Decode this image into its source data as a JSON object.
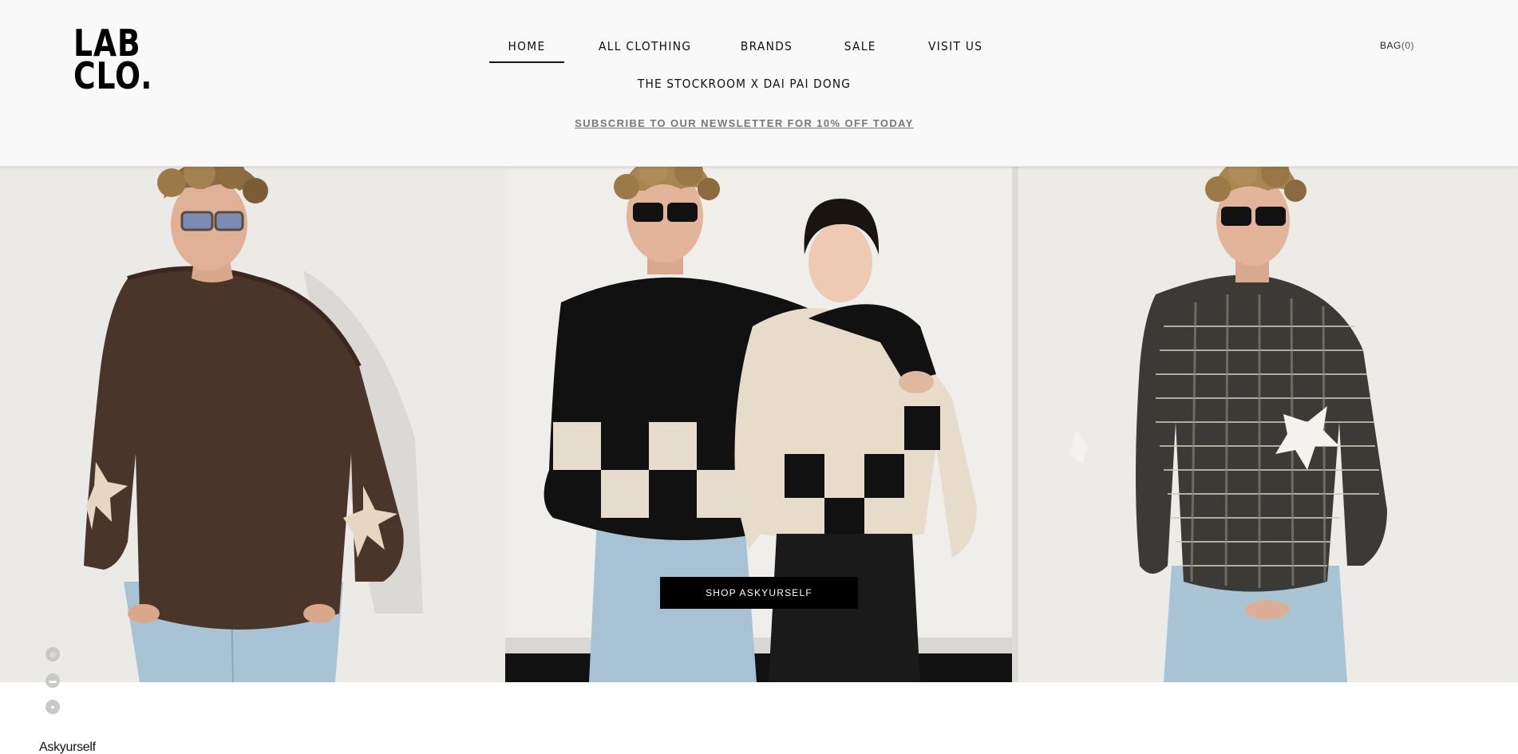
{
  "header": {
    "logo": {
      "line1": "LAB",
      "line2": "CLO."
    },
    "nav": [
      {
        "label": "HOME",
        "active": true
      },
      {
        "label": "ALL CLOTHING",
        "active": false
      },
      {
        "label": "BRANDS",
        "active": false
      },
      {
        "label": "SALE",
        "active": false
      },
      {
        "label": "VISIT US",
        "active": false
      }
    ],
    "nav_secondary": "THE STOCKROOM X DAI PAI DONG",
    "newsletter": "SUBSCRIBE TO OUR NEWSLETTER FOR 10% OFF TODAY",
    "bag": {
      "label": "BAG",
      "count": "(0)"
    }
  },
  "hero": {
    "cta": "SHOP ASKYURSELF",
    "panels": [
      {
        "sweater": "brown knit with cream star on sleeve"
      },
      {
        "sweater": "black and cream checkered knit"
      },
      {
        "sweater": "black and white marled knit with cross patches"
      }
    ]
  },
  "social": [
    {
      "icon": "instagram-icon"
    },
    {
      "icon": "message-icon"
    },
    {
      "icon": "wechat-icon"
    }
  ],
  "section": {
    "label": "Askyurself"
  },
  "colors": {
    "header_bg": "#f9f9f9",
    "text": "#111111",
    "newsletter": "#777777",
    "button_bg": "#000000",
    "button_text": "#ffffff"
  }
}
